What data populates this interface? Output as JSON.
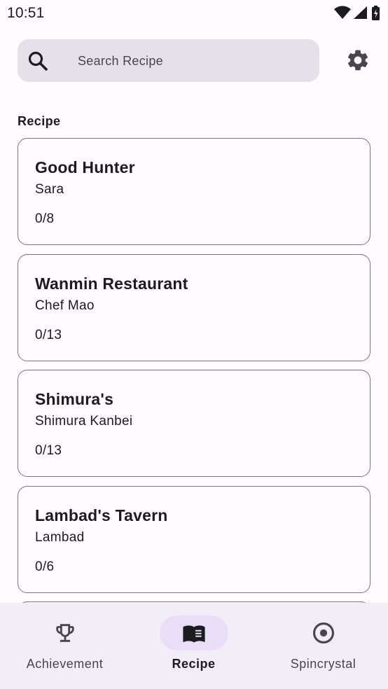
{
  "status_bar": {
    "time": "10:51"
  },
  "search": {
    "placeholder": "Search Recipe",
    "value": ""
  },
  "section": {
    "label": "Recipe"
  },
  "recipes": [
    {
      "title": "Good Hunter",
      "chef": "Sara",
      "progress": "0/8"
    },
    {
      "title": "Wanmin Restaurant",
      "chef": "Chef Mao",
      "progress": "0/13"
    },
    {
      "title": "Shimura's",
      "chef": "Shimura Kanbei",
      "progress": "0/13"
    },
    {
      "title": "Lambad's Tavern",
      "chef": "Lambad",
      "progress": "0/6"
    }
  ],
  "bottom_nav": {
    "items": [
      {
        "label": "Achievement",
        "icon": "trophy-icon",
        "active": false
      },
      {
        "label": "Recipe",
        "icon": "book-icon",
        "active": true
      },
      {
        "label": "Spincrystal",
        "icon": "disc-icon",
        "active": false
      }
    ]
  },
  "colors": {
    "background": "#fffbfe",
    "search_bg": "#e6e0e9",
    "nav_bg": "#f3edf7",
    "nav_active_indicator": "#e8def8",
    "card_border": "#79747e"
  }
}
